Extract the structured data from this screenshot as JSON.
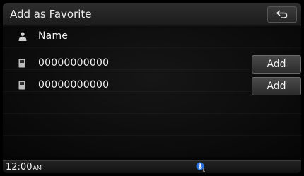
{
  "header": {
    "title": "Add as Favorite",
    "back_icon": "back-arrow-icon"
  },
  "rows": [
    {
      "icon": "person-icon",
      "label": "Name"
    },
    {
      "icon": "phone-icon",
      "label": "00000000000",
      "button": "Add"
    },
    {
      "icon": "phone-icon",
      "label": "00000000000",
      "button": "Add"
    }
  ],
  "status": {
    "time": "12:00",
    "ampm": "AM",
    "bluetooth_icon": "bluetooth-phone-icon"
  },
  "colors": {
    "background": "#050505",
    "accent": "#2a6fd6"
  }
}
